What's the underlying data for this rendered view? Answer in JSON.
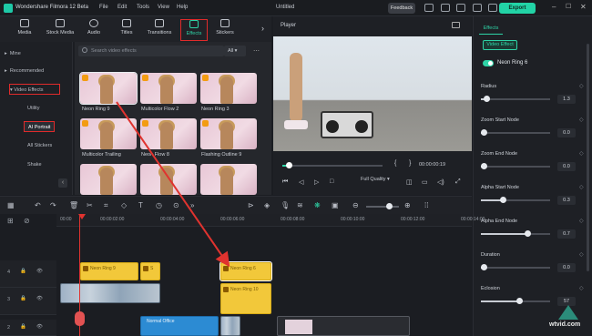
{
  "titlebar": {
    "app_title": "Wondershare Filmora 12 Beta",
    "menu": [
      "File",
      "Edit",
      "Tools",
      "View",
      "Help"
    ],
    "project": "Untitled",
    "feedback": "Feedback",
    "export": "Export"
  },
  "media_tabs": [
    {
      "label": "Media",
      "icon": "media-icon"
    },
    {
      "label": "Stock Media",
      "icon": "stock-media-icon"
    },
    {
      "label": "Audio",
      "icon": "audio-icon"
    },
    {
      "label": "Titles",
      "icon": "titles-icon"
    },
    {
      "label": "Transitions",
      "icon": "transitions-icon"
    },
    {
      "label": "Effects",
      "icon": "effects-icon"
    },
    {
      "label": "Stickers",
      "icon": "stickers-icon"
    }
  ],
  "left_nav": {
    "mine": "Mine",
    "recommended": "Recommended",
    "video_effects": "Video Effects",
    "utility": "Utility",
    "ai_portrait": "AI Portrait",
    "all_stickers": "All Stickers",
    "shake": "Shake"
  },
  "search": {
    "placeholder": "Search video effects",
    "filter": "All"
  },
  "effects": [
    "Neon Ring 9",
    "Multicolor Flow 2",
    "Neon Ring 3",
    "Multicolor Trailing",
    "Neon Flow 8",
    "Flashing Outline 9"
  ],
  "player": {
    "label": "Player",
    "time_current": "00:00:00:19",
    "quality": "Full Quality"
  },
  "panel": {
    "tab": "Effects",
    "subtab": "Video Effect",
    "effect_name": "Neon Ring 6",
    "params": [
      {
        "label": "Radius",
        "value": "1.3",
        "level": 0.05
      },
      {
        "label": "Zoom Start Node",
        "value": "0.0",
        "level": 0.0
      },
      {
        "label": "Zoom End Node",
        "value": "0.0",
        "level": 0.0
      },
      {
        "label": "Alpha Start Node",
        "value": "0.3",
        "level": 0.3
      },
      {
        "label": "Alpha End Node",
        "value": "0.7",
        "level": 0.7
      },
      {
        "label": "Duration",
        "value": "0.0",
        "level": 0.0
      },
      {
        "label": "Eclosion",
        "value": "57",
        "level": 0.57
      }
    ]
  },
  "timeline": {
    "ruler": [
      "00:00",
      "00:00:02:00",
      "00:00:04:00",
      "00:00:06:00",
      "00:00:08:00",
      "00:00:10:00",
      "00:00:12:00",
      "00:00:14:00"
    ],
    "tracks": [
      "4",
      "3",
      "2"
    ],
    "clips": {
      "neon_ring_a": "Neon Ring 9",
      "neon_ring_b": "Neon Ring 6",
      "neon_ring_c": "Neon Ring 10",
      "short_clip": "S",
      "audio_clip": "Normal Office"
    }
  },
  "watermark": "wtvid.com"
}
